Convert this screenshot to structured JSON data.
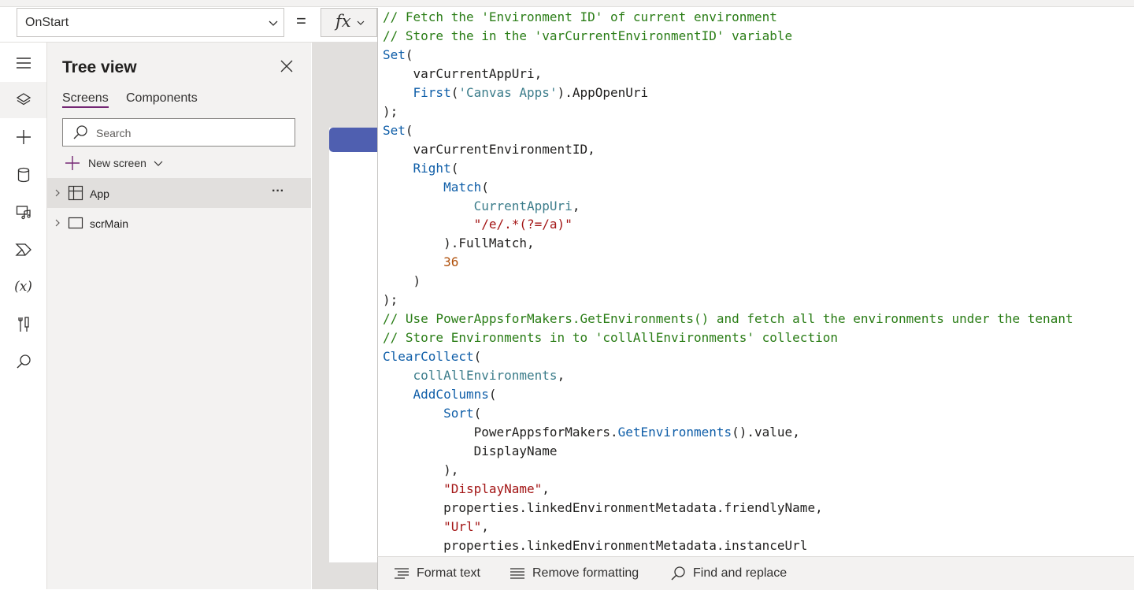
{
  "formula_bar": {
    "property_value": "OnStart",
    "equals": "=",
    "fx_label": "fx"
  },
  "rail": {
    "items": [
      {
        "icon": "hamburger-menu-icon"
      },
      {
        "icon": "tree-view-layers-icon",
        "active": true
      },
      {
        "icon": "insert-plus-icon"
      },
      {
        "icon": "data-cylinder-icon"
      },
      {
        "icon": "media-icon"
      },
      {
        "icon": "power-automate-icon"
      },
      {
        "icon": "variables-icon"
      },
      {
        "icon": "advanced-tools-icon"
      },
      {
        "icon": "search-icon"
      }
    ],
    "variables_label": "(x)"
  },
  "tree": {
    "title": "Tree view",
    "tabs": [
      "Screens",
      "Components"
    ],
    "search_placeholder": "Search",
    "new_screen_label": "New screen",
    "items": [
      {
        "label": "App",
        "more": "···",
        "selected": true
      },
      {
        "label": "scrMain",
        "selected": false
      }
    ]
  },
  "code_lines": [
    [
      {
        "t": "// Fetch the 'Environment ID' of current environment",
        "k": "c"
      }
    ],
    [
      {
        "t": "// Store the in the 'varCurrentEnvironmentID' variable",
        "k": "c"
      }
    ],
    [
      {
        "t": "Set",
        "k": "f"
      },
      {
        "t": "(",
        "k": ""
      }
    ],
    [
      {
        "t": "    varCurrentAppUri,",
        "k": ""
      }
    ],
    [
      {
        "t": "    ",
        "k": ""
      },
      {
        "t": "First",
        "k": "f"
      },
      {
        "t": "(",
        "k": ""
      },
      {
        "t": "'Canvas Apps'",
        "k": "v"
      },
      {
        "t": ").AppOpenUri",
        "k": ""
      }
    ],
    [
      {
        "t": ");",
        "k": ""
      }
    ],
    [
      {
        "t": "Set",
        "k": "f"
      },
      {
        "t": "(",
        "k": ""
      }
    ],
    [
      {
        "t": "    varCurrentEnvironmentID,",
        "k": ""
      }
    ],
    [
      {
        "t": "    ",
        "k": ""
      },
      {
        "t": "Right",
        "k": "f"
      },
      {
        "t": "(",
        "k": ""
      }
    ],
    [
      {
        "t": "        ",
        "k": ""
      },
      {
        "t": "Match",
        "k": "f"
      },
      {
        "t": "(",
        "k": ""
      }
    ],
    [
      {
        "t": "            ",
        "k": ""
      },
      {
        "t": "CurrentAppUri",
        "k": "v"
      },
      {
        "t": ",",
        "k": ""
      }
    ],
    [
      {
        "t": "            ",
        "k": ""
      },
      {
        "t": "\"/e/.*(?=/a)\"",
        "k": "s"
      }
    ],
    [
      {
        "t": "        ).FullMatch,",
        "k": ""
      }
    ],
    [
      {
        "t": "        ",
        "k": ""
      },
      {
        "t": "36",
        "k": "n"
      }
    ],
    [
      {
        "t": "    )",
        "k": ""
      }
    ],
    [
      {
        "t": ");",
        "k": ""
      }
    ],
    [
      {
        "t": "// Use PowerAppsforMakers.GetEnvironments() and fetch all the environments under the tenant",
        "k": "c"
      }
    ],
    [
      {
        "t": "// Store Environments in to 'collAllEnvironments' collection",
        "k": "c"
      }
    ],
    [
      {
        "t": "ClearCollect",
        "k": "f"
      },
      {
        "t": "(",
        "k": ""
      }
    ],
    [
      {
        "t": "    ",
        "k": ""
      },
      {
        "t": "collAllEnvironments",
        "k": "v"
      },
      {
        "t": ",",
        "k": ""
      }
    ],
    [
      {
        "t": "    ",
        "k": ""
      },
      {
        "t": "AddColumns",
        "k": "f"
      },
      {
        "t": "(",
        "k": ""
      }
    ],
    [
      {
        "t": "        ",
        "k": ""
      },
      {
        "t": "Sort",
        "k": "f"
      },
      {
        "t": "(",
        "k": ""
      }
    ],
    [
      {
        "t": "            PowerAppsforMakers.",
        "k": ""
      },
      {
        "t": "GetEnvironments",
        "k": "f"
      },
      {
        "t": "().value,",
        "k": ""
      }
    ],
    [
      {
        "t": "            DisplayName",
        "k": ""
      }
    ],
    [
      {
        "t": "        ),",
        "k": ""
      }
    ],
    [
      {
        "t": "        ",
        "k": ""
      },
      {
        "t": "\"DisplayName\"",
        "k": "s"
      },
      {
        "t": ",",
        "k": ""
      }
    ],
    [
      {
        "t": "        properties.linkedEnvironmentMetadata.friendlyName,",
        "k": ""
      }
    ],
    [
      {
        "t": "        ",
        "k": ""
      },
      {
        "t": "\"Url\"",
        "k": "s"
      },
      {
        "t": ",",
        "k": ""
      }
    ],
    [
      {
        "t": "        properties.linkedEnvironmentMetadata.instanceUrl",
        "k": ""
      }
    ]
  ],
  "code_colors": {
    "comment": "#2a7d16",
    "function": "#0f5ea8",
    "string": "#a31515",
    "number": "#b0510c",
    "identifier": "#3b7c8a"
  },
  "bottom_bar": {
    "format_text": "Format text",
    "remove_formatting": "Remove formatting",
    "find_replace": "Find and replace"
  },
  "colors": {
    "accent": "#742774",
    "canvas_header": "#4f5fb0"
  }
}
